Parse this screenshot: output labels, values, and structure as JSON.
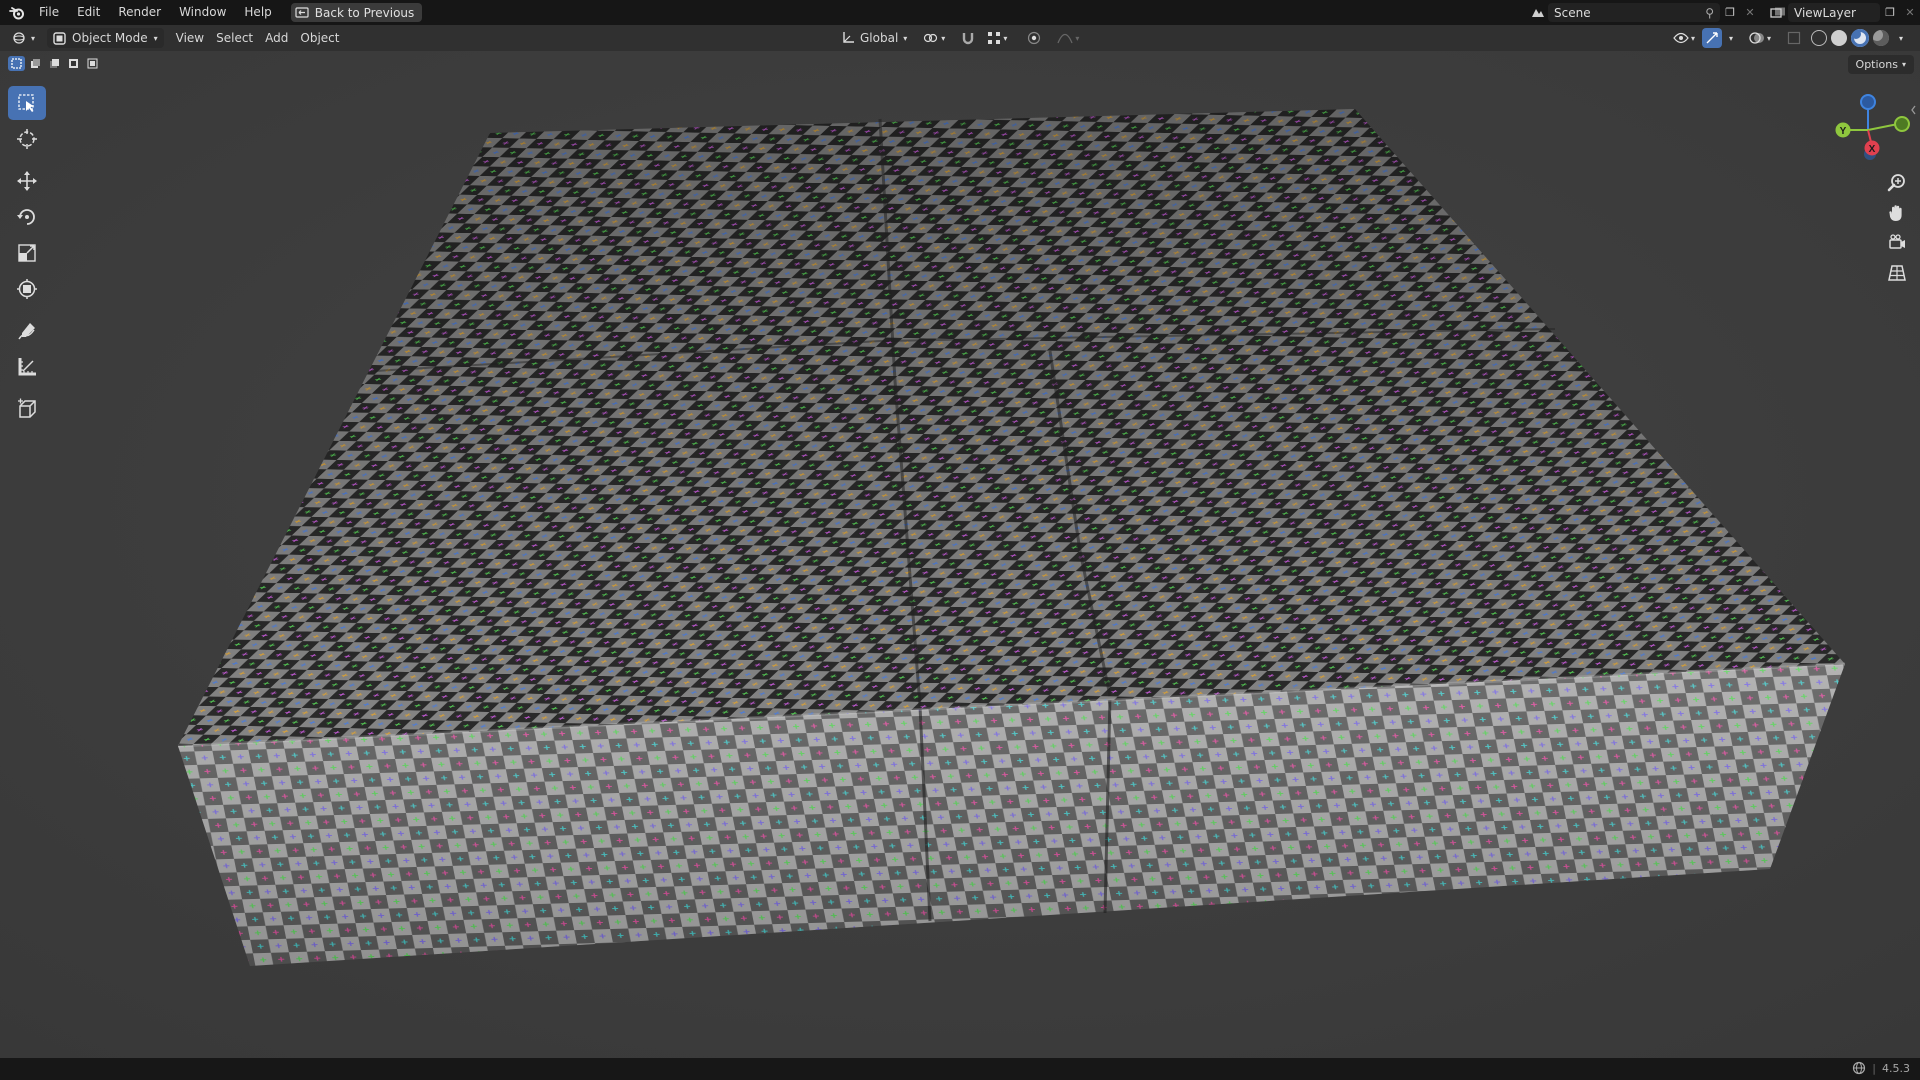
{
  "topbar": {
    "menu": [
      "File",
      "Edit",
      "Render",
      "Window",
      "Help"
    ],
    "back_button": "Back to Previous",
    "scene": "Scene",
    "view_layer": "ViewLayer"
  },
  "header": {
    "mode": "Object Mode",
    "menus": [
      "View",
      "Select",
      "Add",
      "Object"
    ],
    "orientation": "Global"
  },
  "options": "Options",
  "gizmo_axes": {
    "x": "X",
    "y": "Y",
    "z": "Z"
  },
  "toolbar": [
    "select-box",
    "cursor",
    "move",
    "rotate",
    "scale",
    "transform",
    "annotate",
    "measure",
    "add-cube"
  ],
  "status": {
    "version": "4.5.3"
  },
  "colors": {
    "accent": "#4772b3",
    "x_axis": "#e0404f",
    "y_axis": "#8fc73e",
    "z_axis": "#3f84e0",
    "checker_dark": "#2b2b2b",
    "checker_light": "#8d8d8d"
  }
}
